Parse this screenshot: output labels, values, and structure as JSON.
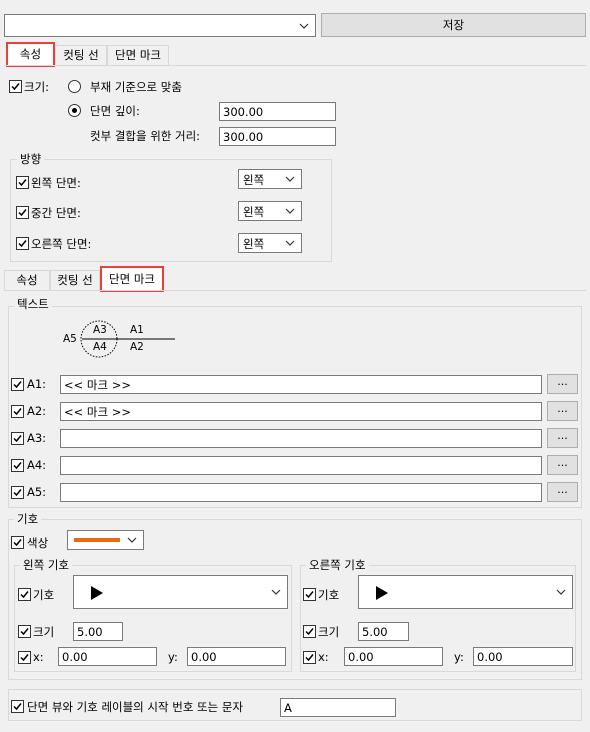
{
  "top": {
    "combo_value": "",
    "save_label": "저장"
  },
  "tabs_top": [
    "속성",
    "컷팅 선",
    "단면 마크"
  ],
  "size": {
    "label": "크기:",
    "fit_option": "부재 기준으로 맞춤",
    "depth_option": "단면 깊이:",
    "depth_value": "300.00",
    "cut_distance_label": "컷부 결합을 위한 거리:",
    "cut_distance_value": "300.00"
  },
  "direction": {
    "title": "방향",
    "rows": [
      {
        "label": "왼쪽 단면:",
        "value": "왼쪽"
      },
      {
        "label": "중간 단면:",
        "value": "왼쪽"
      },
      {
        "label": "오른쪽 단면:",
        "value": "왼쪽"
      }
    ]
  },
  "tabs_bottom": [
    "속성",
    "컷팅 선",
    "단면 마크"
  ],
  "text_group": {
    "title": "텍스트",
    "preview": {
      "a5": "A5",
      "a3": "A3",
      "a4": "A4",
      "a1": "A1",
      "a2": "A2"
    },
    "rows": [
      {
        "label": "A1:",
        "value": "<< 마크 >>"
      },
      {
        "label": "A2:",
        "value": "<< 마크 >>"
      },
      {
        "label": "A3:",
        "value": ""
      },
      {
        "label": "A4:",
        "value": ""
      },
      {
        "label": "A5:",
        "value": ""
      }
    ],
    "browse_label": "..."
  },
  "symbol_group": {
    "title": "기호",
    "color_label": "색상",
    "color": "#e86a10",
    "left": {
      "title": "왼쪽 기호",
      "symbol_label": "기호",
      "size_label": "크기",
      "size_value": "5.00",
      "x_label": "x:",
      "x_value": "0.00",
      "y_label": "y:",
      "y_value": "0.00"
    },
    "right": {
      "title": "오른쪽 기호",
      "symbol_label": "기호",
      "size_label": "크기",
      "size_value": "5.00",
      "x_label": "x:",
      "x_value": "0.00",
      "y_label": "y:",
      "y_value": "0.00"
    }
  },
  "start_label": {
    "label": "단면 뷰와 기호 레이블의 시작 번호 또는 문자",
    "value": "A"
  },
  "colors": {
    "highlight": "#e8403d",
    "accent_line": "#e86a10"
  }
}
